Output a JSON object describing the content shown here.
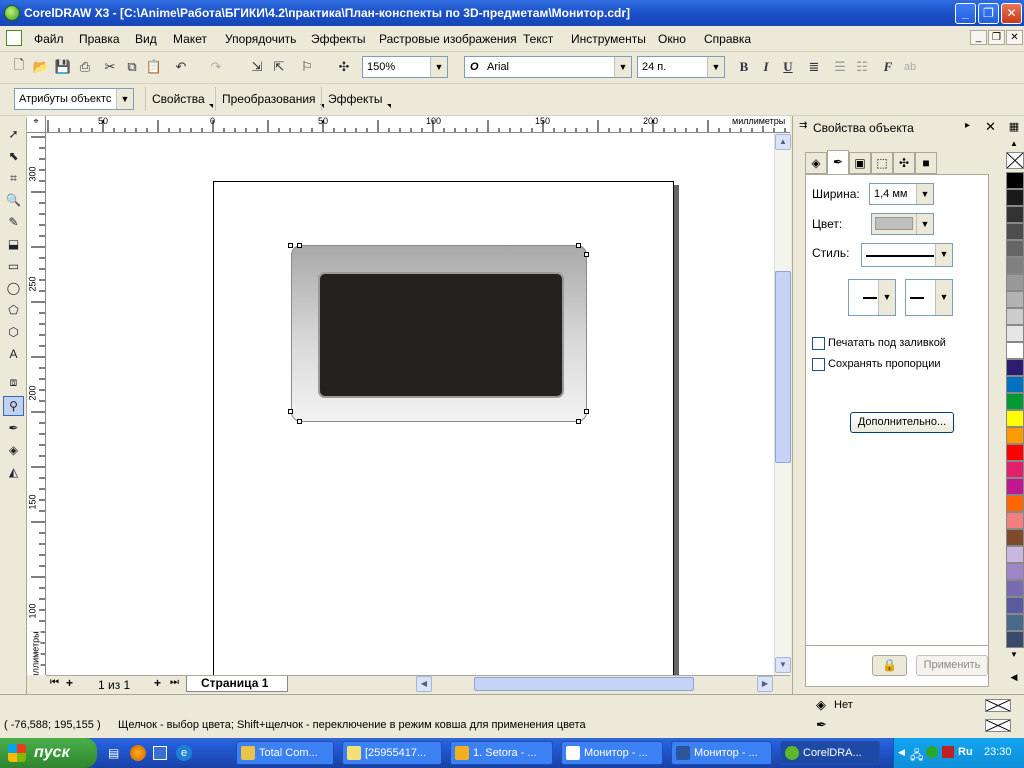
{
  "window": {
    "title": "CorelDRAW X3 - [C:\\Anime\\Работа\\БГИКИ\\4.2\\практика\\План-конспекты по 3D-предметам\\Монитор.cdr]"
  },
  "menu": [
    "Файл",
    "Правка",
    "Вид",
    "Макет",
    "Упорядочить",
    "Эффекты",
    "Растровые изображения",
    "Текст",
    "Инструменты",
    "Окно",
    "Справка"
  ],
  "standard_toolbar": {
    "zoom": "150%",
    "font": "Arial",
    "font_size": "24 п.",
    "bold": "B",
    "italic": "I",
    "underline": "U",
    "ab": "ab"
  },
  "property_bar": {
    "attributes": "Атрибуты объектс",
    "properties": "Свойства",
    "transform": "Преобразования",
    "effects": "Эффекты"
  },
  "ruler": {
    "units": "миллиметры",
    "h_ticks": [
      "50",
      "0",
      "50",
      "100",
      "150",
      "200"
    ],
    "v_ticks": [
      "300",
      "250",
      "200",
      "150",
      "100"
    ]
  },
  "page_nav": {
    "counter": "1 из 1",
    "tab": "Страница 1"
  },
  "docker": {
    "title": "Свойства объекта",
    "width_label": "Ширина:",
    "width_value": "1,4 мм",
    "color_label": "Цвет:",
    "style_label": "Стиль:",
    "print_under_fill": "Печатать под заливкой",
    "keep_proportions": "Сохранять пропорции",
    "advanced_button": "Дополнительно...",
    "apply_button": "Применить"
  },
  "status": {
    "coords": "( -76,588; 195,155 )",
    "message": "Щелчок - выбор цвета; Shift+щелчок - переключение в режим ковша для применения цвета",
    "fill_none": "Нет"
  },
  "palette_colors": [
    "#000000",
    "#1a1a1a",
    "#333333",
    "#4d4d4d",
    "#666666",
    "#808080",
    "#999999",
    "#b3b3b3",
    "#cccccc",
    "#e6e6e6",
    "#ffffff",
    "#2e1a6e",
    "#0070c0",
    "#009933",
    "#ffff00",
    "#ff9900",
    "#ff0000",
    "#e0206a",
    "#c01890",
    "#ff6600",
    "#f08080",
    "#7f4a2a",
    "#c8b8e0",
    "#9e86c8",
    "#7a6aaf",
    "#5a5a9f",
    "#4a6a8a",
    "#3a4a6a"
  ],
  "taskbar": {
    "start": "пуск",
    "tasks": [
      "Total Com...",
      "[25955417...",
      "1. Setora - ...",
      "Монитор - ...",
      "Монитор - ...",
      "CorelDRA..."
    ],
    "lang": "Ru",
    "clock": "23:30"
  }
}
